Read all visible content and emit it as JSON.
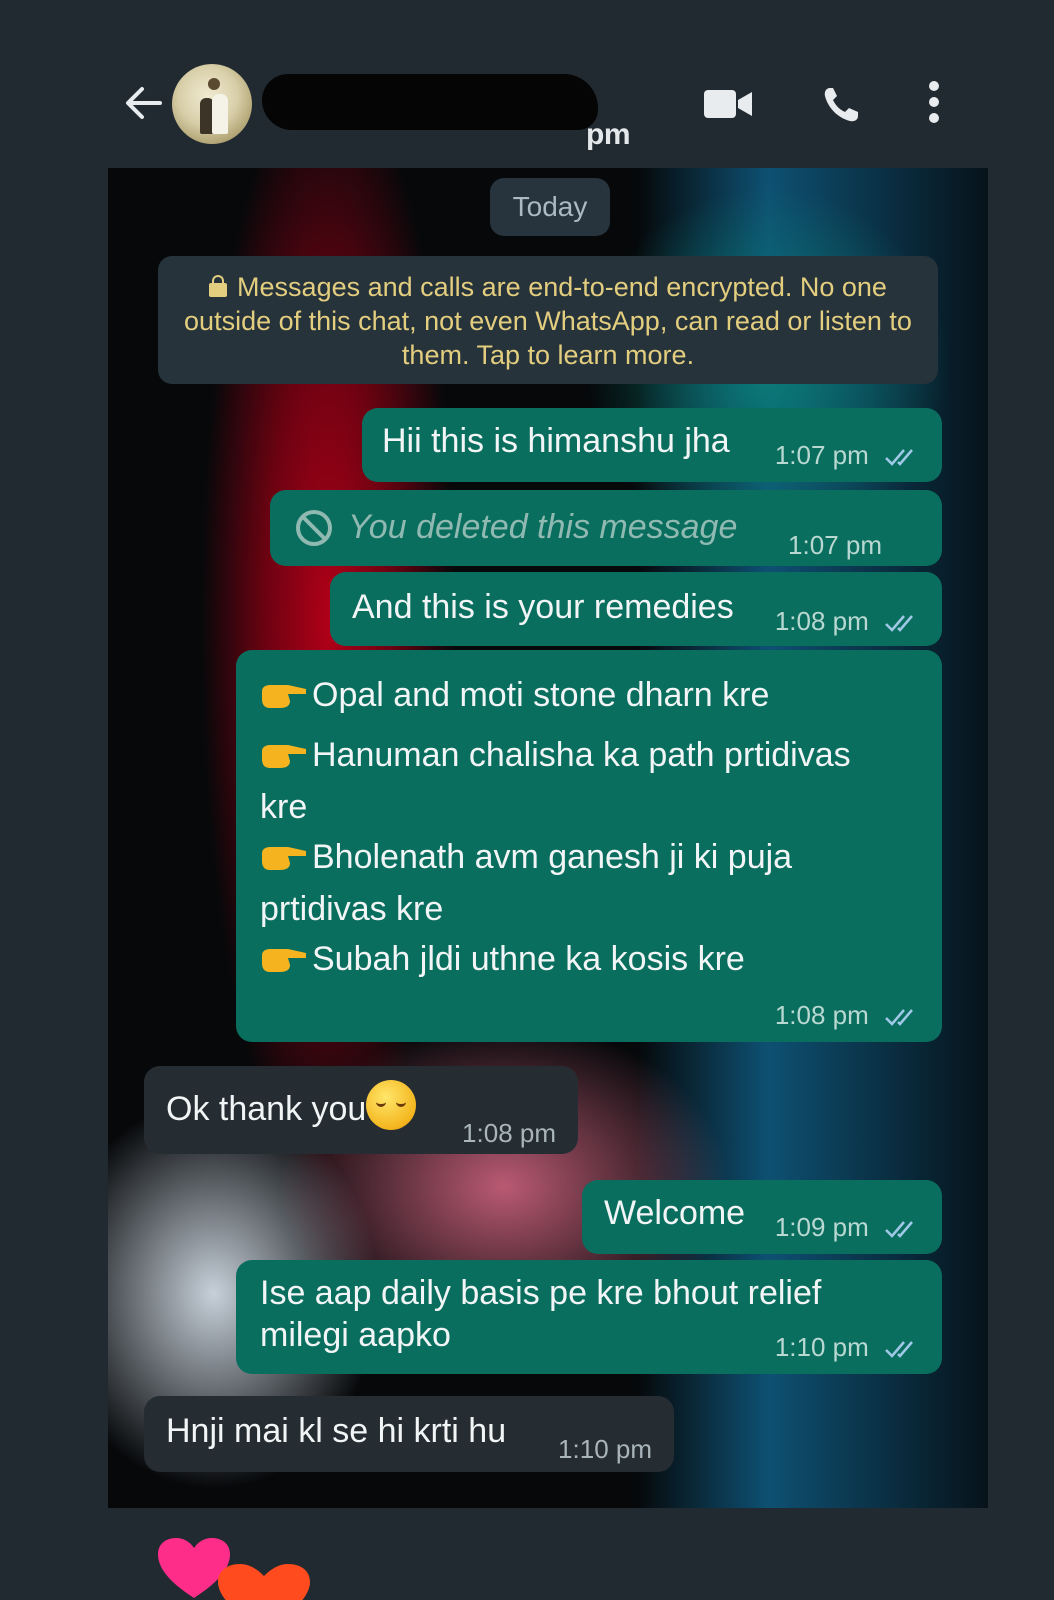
{
  "header": {
    "status_text": "pm",
    "icons": [
      "back-arrow-icon",
      "video-call-icon",
      "voice-call-icon",
      "more-options-icon"
    ]
  },
  "chat": {
    "date_label": "Today",
    "encryption_notice": "Messages and calls are end-to-end encrypted. No one outside of this chat, not even WhatsApp, can read or listen to them. Tap to learn more.",
    "messages": [
      {
        "direction": "out",
        "text": "Hii this is himanshu jha",
        "time": "1:07 pm",
        "status": "read"
      },
      {
        "direction": "out",
        "text": "You deleted this message",
        "time": "1:07 pm",
        "deleted": true
      },
      {
        "direction": "out",
        "text": "And this is your remedies",
        "time": "1:08 pm",
        "status": "read"
      },
      {
        "direction": "out",
        "lines": [
          "Opal  and moti stone dharn kre",
          "Hanuman chalisha ka path prtidivas",
          "kre",
          "Bholenath avm ganesh  ji ki puja",
          "prtidivas kre",
          "Subah jldi uthne ka kosis kre"
        ],
        "time": "1:08 pm",
        "status": "read"
      },
      {
        "direction": "in",
        "text": "Ok thank you",
        "time": "1:08 pm"
      },
      {
        "direction": "out",
        "text": "Welcome",
        "time": "1:09 pm",
        "status": "read"
      },
      {
        "direction": "out",
        "lines": [
          "Ise aap daily basis pe kre bhout relief",
          "milegi  aapko"
        ],
        "time": "1:10 pm",
        "status": "read"
      },
      {
        "direction": "in",
        "text": "Hnji mai kl se hi krti hu",
        "time": "1:10 pm"
      }
    ]
  },
  "colors": {
    "outgoing_bubble": "#0a6e5f",
    "incoming_bubble": "#252d33",
    "notice_text": "#e3cd7e",
    "read_tick": "#9fc9e6"
  }
}
